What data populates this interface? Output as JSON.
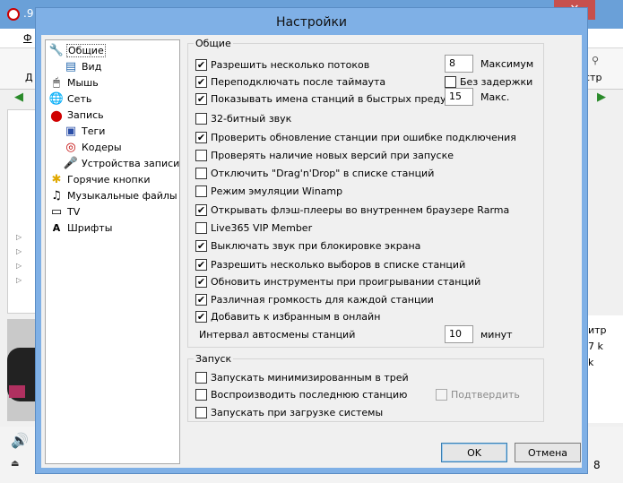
{
  "background_app": {
    "title_fragment": ".9",
    "menu_fragment": "Ф",
    "toolbar_left_fragment": "Д",
    "toolbar_right_fragment": "стр",
    "right_column_lines": [
      "итр",
      "7 k",
      "k"
    ],
    "bottom_number": "8",
    "close_symbol": "✕"
  },
  "dialog": {
    "title": "Настройки",
    "tree": [
      {
        "label": "Общие",
        "icon": "wrench-icon",
        "glyph": "🔧",
        "selected": true
      },
      {
        "label": "Вид",
        "icon": "window-icon",
        "glyph": "▤"
      },
      {
        "label": "Мышь",
        "icon": "mouse-icon",
        "glyph": "🖱"
      },
      {
        "label": "Сеть",
        "icon": "network-icon",
        "glyph": "🌐"
      },
      {
        "label": "Запись",
        "icon": "record-icon",
        "glyph": "●"
      },
      {
        "label": "Теги",
        "icon": "tag-icon",
        "glyph": "▣"
      },
      {
        "label": "Кодеры",
        "icon": "codec-icon",
        "glyph": "◎"
      },
      {
        "label": "Устройства записи",
        "icon": "microphone-icon",
        "glyph": "🎤"
      },
      {
        "label": "Горячие кнопки",
        "icon": "hotkey-icon",
        "glyph": "✱"
      },
      {
        "label": "Музыкальные файлы",
        "icon": "music-note-icon",
        "glyph": "♫"
      },
      {
        "label": "TV",
        "icon": "tv-icon",
        "glyph": "▭"
      },
      {
        "label": "Шрифты",
        "icon": "font-icon",
        "glyph": "A"
      }
    ],
    "general": {
      "legend": "Общие",
      "options": [
        {
          "label": "Разрешить несколько потоков",
          "checked": true
        },
        {
          "label": "Переподключать после таймаута",
          "checked": true
        },
        {
          "label": "Показывать имена станций в быстрых предуста",
          "checked": true
        },
        {
          "label": "32-битный звук",
          "checked": false
        },
        {
          "label": "Проверить обновление станции при ошибке подключения",
          "checked": true
        },
        {
          "label": "Проверять наличие новых версий при запуске",
          "checked": false
        },
        {
          "label": "Отключить \"Drag'n'Drop\" в списке станций",
          "checked": false
        },
        {
          "label": "Режим эмуляции Winamp",
          "checked": false
        },
        {
          "label": "Открывать флэш-плееры во внутреннем браузере Rarma",
          "checked": true
        },
        {
          "label": "Live365 VIP Member",
          "checked": false
        },
        {
          "label": "Выключать звук при блокировке экрана",
          "checked": true
        },
        {
          "label": "Разрешить несколько выборов в списке станций",
          "checked": true
        },
        {
          "label": "Обновить инструменты при проигрывании станций",
          "checked": true
        },
        {
          "label": "Различная громкость для каждой станции",
          "checked": true
        },
        {
          "label": "Добавить к избранным в онлайн",
          "checked": true
        }
      ],
      "max_streams_value": "8",
      "max_streams_label": "Максимум",
      "no_delay_label": "Без задержки",
      "no_delay_checked": false,
      "max_presets_value": "15",
      "max_presets_label": "Макс.",
      "interval_label": "Интервал автосмены станций",
      "interval_value": "10",
      "interval_unit": "минут"
    },
    "startup": {
      "legend": "Запуск",
      "options": [
        {
          "label": "Запускать минимизированным в трей",
          "checked": false
        },
        {
          "label": "Воспроизводить последнюю станцию",
          "checked": false
        },
        {
          "label": "Запускать при загрузке системы",
          "checked": false
        }
      ],
      "confirm_label": "Подтвердить",
      "confirm_checked": false
    },
    "buttons": {
      "ok": "OK",
      "cancel": "Отмена"
    }
  }
}
